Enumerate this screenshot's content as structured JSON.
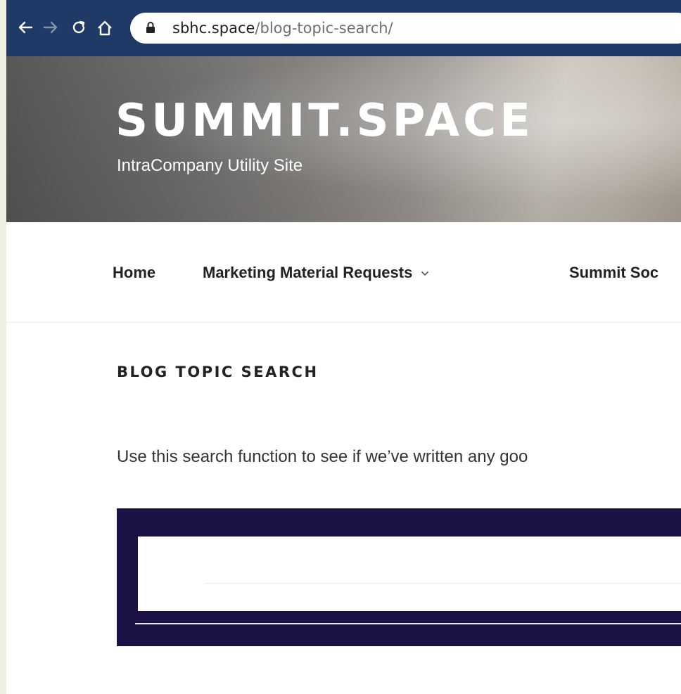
{
  "browser": {
    "url_host": "sbhc.space",
    "url_path": "/blog-topic-search/",
    "back_icon": "back-arrow-icon",
    "forward_icon": "forward-arrow-icon",
    "reload_icon": "reload-icon",
    "home_icon": "home-icon",
    "lock_icon": "lock-icon"
  },
  "site": {
    "title": "SUMMIT.SPACE",
    "tagline": "IntraCompany Utility Site"
  },
  "nav": {
    "items": [
      {
        "label": "Home"
      },
      {
        "label": "Marketing Material Requests",
        "has_dropdown": true
      },
      {
        "label": "Summit Soc"
      }
    ]
  },
  "page": {
    "title": "BLOG TOPIC SEARCH",
    "intro": "Use this search function to see if we’ve written any goo"
  },
  "search": {
    "value": "",
    "placeholder": ""
  },
  "colors": {
    "toolbar": "#1f3a66",
    "search_frame": "#1b1145",
    "left_strip": "#eef1e1"
  }
}
